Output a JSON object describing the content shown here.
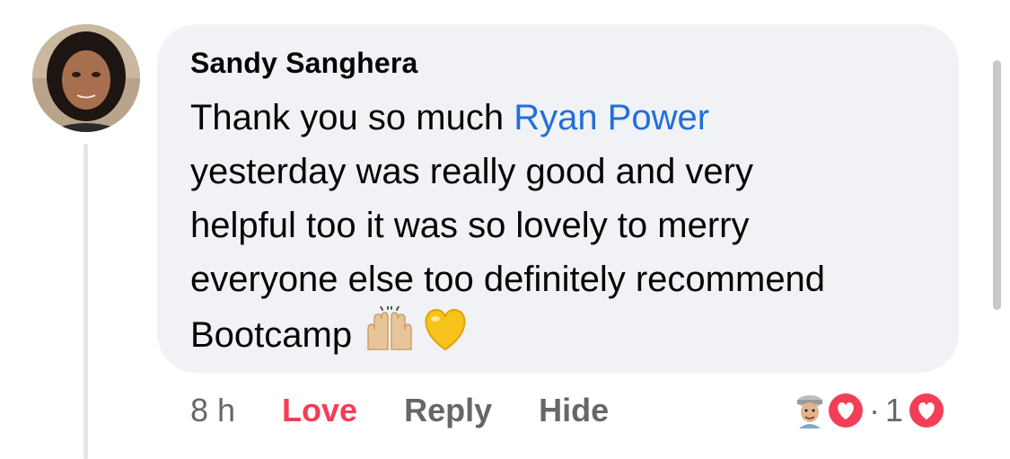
{
  "comment": {
    "author": "Sandy Sanghera",
    "lines": [
      {
        "before": "Thank you so much ",
        "mention": "Ryan Power"
      },
      {
        "text": "yesterday was really good and very"
      },
      {
        "text": "helpful too it was so lovely to merry"
      },
      {
        "text": "everyone else too definitely recommend"
      },
      {
        "text": "Bootcamp"
      }
    ],
    "emojis": [
      "raising-hands-emoji",
      "yellow-heart-emoji"
    ]
  },
  "actions": {
    "time": "8 h",
    "love_label": "Love",
    "reply_label": "Reply",
    "hide_label": "Hide"
  },
  "reactions": {
    "dot": "·",
    "count": "1",
    "icon": "love-reaction-icon"
  },
  "colors": {
    "bubble_bg": "#f0f2f5",
    "mention": "#216fdb",
    "love": "#f33e58",
    "secondary_text": "#65676b"
  }
}
